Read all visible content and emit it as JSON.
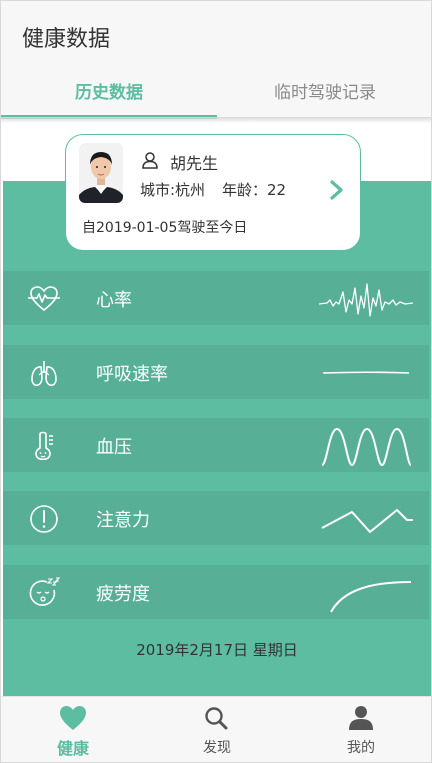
{
  "header": {
    "title": "健康数据"
  },
  "tabs": [
    {
      "label": "历史数据",
      "active": true
    },
    {
      "label": "临时驾驶记录",
      "active": false
    }
  ],
  "profile": {
    "name": "胡先生",
    "city": "城市:杭州",
    "age": "年龄：22",
    "since": "自2019-01-05驾驶至今日"
  },
  "metrics": [
    {
      "label": "心率",
      "icon": "heart-pulse-icon"
    },
    {
      "label": "呼吸速率",
      "icon": "lungs-icon"
    },
    {
      "label": "血压",
      "icon": "thermometer-icon"
    },
    {
      "label": "注意力",
      "icon": "alert-icon"
    },
    {
      "label": "疲劳度",
      "icon": "sleepy-face-icon"
    }
  ],
  "date": "2019年2月17日 星期日",
  "nav": [
    {
      "label": "健康",
      "icon": "heart-icon",
      "active": true
    },
    {
      "label": "发现",
      "icon": "search-icon",
      "active": false
    },
    {
      "label": "我的",
      "icon": "person-icon",
      "active": false
    }
  ],
  "colors": {
    "accent": "#5dbda0",
    "row": "#57b095",
    "header": "#f7f7f7"
  }
}
